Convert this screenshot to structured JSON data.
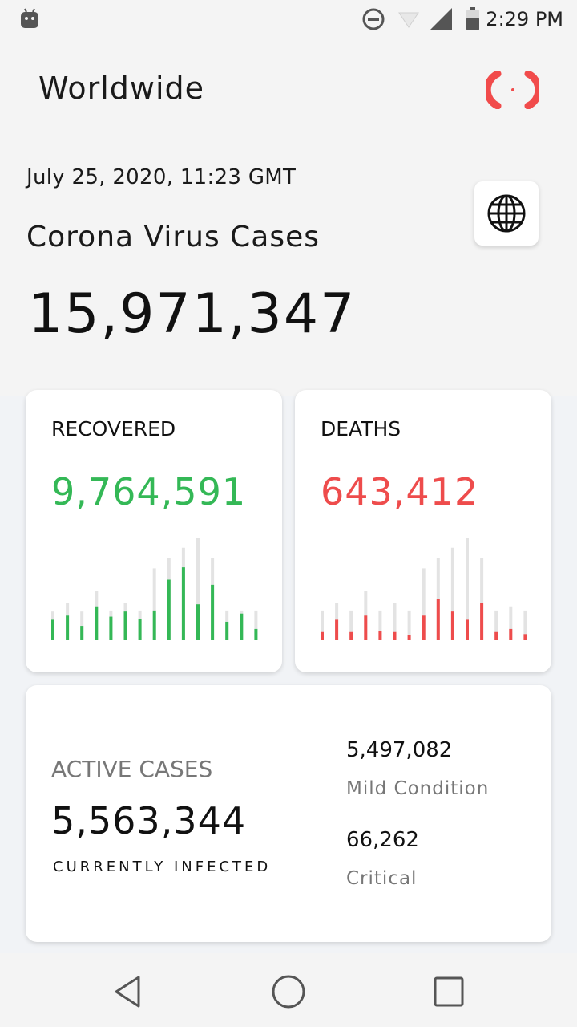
{
  "status_bar": {
    "time": "2:29 PM"
  },
  "header": {
    "title": "Worldwide"
  },
  "summary": {
    "date": "July 25, 2020, 11:23 GMT",
    "label": "Corona Virus Cases",
    "total": "15,971,347"
  },
  "recovered": {
    "label": "RECOVERED",
    "value": "9,764,591",
    "color": "#34b856",
    "bars": [
      {
        "bg": 0.28,
        "fg": 0.2
      },
      {
        "bg": 0.36,
        "fg": 0.24
      },
      {
        "bg": 0.28,
        "fg": 0.14
      },
      {
        "bg": 0.48,
        "fg": 0.33
      },
      {
        "bg": 0.29,
        "fg": 0.23
      },
      {
        "bg": 0.36,
        "fg": 0.28
      },
      {
        "bg": 0.29,
        "fg": 0.21
      },
      {
        "bg": 0.7,
        "fg": 0.29
      },
      {
        "bg": 0.8,
        "fg": 0.59
      },
      {
        "bg": 0.9,
        "fg": 0.71
      },
      {
        "bg": 1.0,
        "fg": 0.35
      },
      {
        "bg": 0.8,
        "fg": 0.54
      },
      {
        "bg": 0.29,
        "fg": 0.18
      },
      {
        "bg": 0.29,
        "fg": 0.26
      },
      {
        "bg": 0.29,
        "fg": 0.11
      }
    ]
  },
  "deaths": {
    "label": "DEATHS",
    "value": "643,412",
    "color": "#ee4c4c",
    "bars": [
      {
        "bg": 0.29,
        "fg": 0.08
      },
      {
        "bg": 0.36,
        "fg": 0.2
      },
      {
        "bg": 0.29,
        "fg": 0.08
      },
      {
        "bg": 0.48,
        "fg": 0.24
      },
      {
        "bg": 0.29,
        "fg": 0.09
      },
      {
        "bg": 0.36,
        "fg": 0.08
      },
      {
        "bg": 0.29,
        "fg": 0.05
      },
      {
        "bg": 0.7,
        "fg": 0.24
      },
      {
        "bg": 0.8,
        "fg": 0.4
      },
      {
        "bg": 0.9,
        "fg": 0.28
      },
      {
        "bg": 1.0,
        "fg": 0.2
      },
      {
        "bg": 0.8,
        "fg": 0.36
      },
      {
        "bg": 0.29,
        "fg": 0.08
      },
      {
        "bg": 0.33,
        "fg": 0.11
      },
      {
        "bg": 0.29,
        "fg": 0.06
      }
    ]
  },
  "active": {
    "label": "ACTIVE CASES",
    "value": "5,563,344",
    "sub": "CURRENTLY INFECTED",
    "mild_value": "5,497,082",
    "mild_label": "Mild Condition",
    "critical_value": "66,262",
    "critical_label": "Critical"
  }
}
